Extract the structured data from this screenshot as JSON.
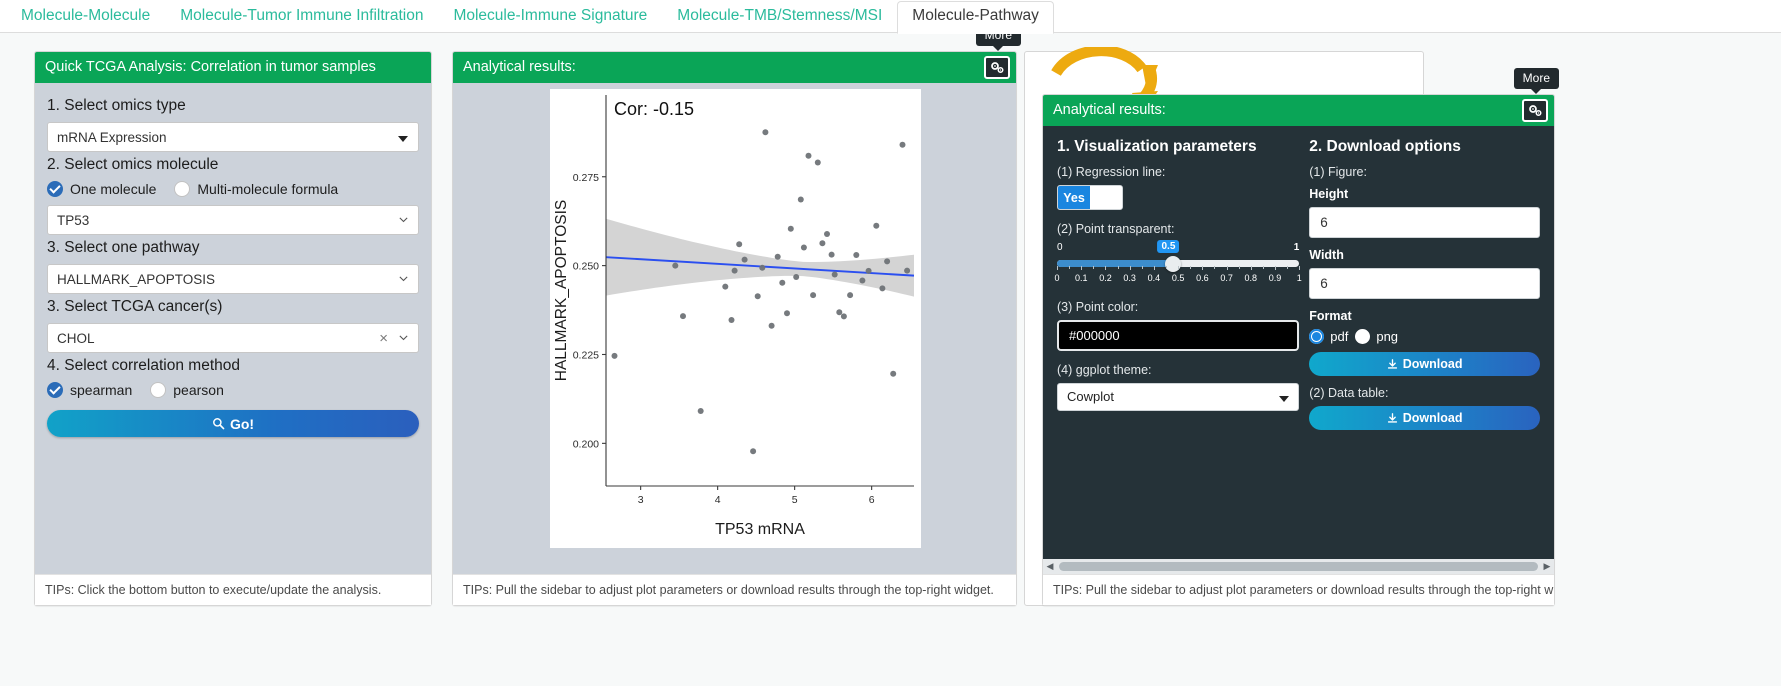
{
  "tabs": [
    {
      "label": "Molecule-Molecule",
      "active": false
    },
    {
      "label": "Molecule-Tumor Immune Infiltration",
      "active": false
    },
    {
      "label": "Molecule-Immune Signature",
      "active": false
    },
    {
      "label": "Molecule-TMB/Stemness/MSI",
      "active": false
    },
    {
      "label": "Molecule-Pathway",
      "active": true
    }
  ],
  "left_panel": {
    "title": "Quick TCGA Analysis: Correlation in tumor samples",
    "step1_label": "1. Select omics type",
    "omics_type_value": "mRNA Expression",
    "step2_label": "2. Select omics molecule",
    "molecule_mode": [
      {
        "label": "One molecule",
        "selected": true
      },
      {
        "label": "Multi-molecule formula",
        "selected": false
      }
    ],
    "molecule_value": "TP53",
    "step3_label": "3. Select one pathway",
    "pathway_value": "HALLMARK_APOPTOSIS",
    "step3b_label": "3. Select TCGA cancer(s)",
    "cancer_value": "CHOL",
    "step4_label": "4. Select correlation method",
    "corr_methods": [
      {
        "label": "spearman",
        "selected": true
      },
      {
        "label": "pearson",
        "selected": false
      }
    ],
    "go_label": "Go!",
    "tip": "TIPs: Click the bottom button to execute/update the analysis."
  },
  "mid_panel": {
    "title": "Analytical results:",
    "gear_tooltip": "More",
    "tip": "TIPs: Pull the sidebar to adjust plot parameters or download results through the top-right widget."
  },
  "right_panel": {
    "title": "Analytical results:",
    "gear_tooltip": "More",
    "viz_title": "1. Visualization parameters",
    "regression_label": "(1) Regression line:",
    "regression_value": "Yes",
    "transparent_label": "(2) Point transparent:",
    "slider_min": "0",
    "slider_max": "1",
    "slider_value": "0.5",
    "slider_ticks": [
      "0",
      "0.1",
      "0.2",
      "0.3",
      "0.4",
      "0.5",
      "0.6",
      "0.7",
      "0.8",
      "0.9",
      "1"
    ],
    "pointcolor_label": "(3) Point color:",
    "pointcolor_value": "#000000",
    "theme_label": "(4) ggplot theme:",
    "theme_value": "Cowplot",
    "download_title": "2. Download options",
    "figure_label": "(1) Figure:",
    "height_label": "Height",
    "height_value": "6",
    "width_label": "Width",
    "width_value": "6",
    "format_label": "Format",
    "formats": [
      {
        "label": "pdf",
        "selected": true
      },
      {
        "label": "png",
        "selected": false
      }
    ],
    "download_fig_label": "Download",
    "datatable_label": "(2) Data table:",
    "download_data_label": "Download",
    "tip": "TIPs: Pull the sidebar to adjust plot parameters or download results through the top-right widget."
  },
  "colors": {
    "accent_green": "#0aa557",
    "tab_teal": "#2bbb9c",
    "panel_body": "#ccd2da",
    "dark_panel": "#253238",
    "regression_line": "#2b4ff0",
    "point_gray": "#6f7377",
    "ribbon_gray": "#d4d4d4",
    "arrow_gold": "#edaa10"
  },
  "chart_data": {
    "type": "scatter",
    "title": "Cor: -0.15",
    "xlabel": "TP53 mRNA",
    "ylabel": "HALLMARK_APOPTOSIS",
    "xticks": [
      3,
      4,
      5,
      6
    ],
    "yticks": [
      0.2,
      0.225,
      0.25,
      0.275
    ],
    "xlim": [
      2.55,
      6.55
    ],
    "ylim": [
      0.188,
      0.298
    ],
    "grid": false,
    "legend": false,
    "regression_line": {
      "show": true,
      "color": "#2b4ff0",
      "slope": -0.0013,
      "intercept": 0.2557
    },
    "confidence_band": {
      "show": true,
      "color": "#d4d4d4",
      "level": 0.95
    },
    "points": [
      {
        "x": 2.66,
        "y": 0.2246
      },
      {
        "x": 3.45,
        "y": 0.25
      },
      {
        "x": 3.55,
        "y": 0.2358
      },
      {
        "x": 3.78,
        "y": 0.2091
      },
      {
        "x": 4.1,
        "y": 0.2441
      },
      {
        "x": 4.18,
        "y": 0.2347
      },
      {
        "x": 4.22,
        "y": 0.2486
      },
      {
        "x": 4.28,
        "y": 0.256
      },
      {
        "x": 4.35,
        "y": 0.2517
      },
      {
        "x": 4.46,
        "y": 0.1978
      },
      {
        "x": 4.52,
        "y": 0.2414
      },
      {
        "x": 4.58,
        "y": 0.2494
      },
      {
        "x": 4.62,
        "y": 0.2875
      },
      {
        "x": 4.7,
        "y": 0.2331
      },
      {
        "x": 4.78,
        "y": 0.2525
      },
      {
        "x": 4.84,
        "y": 0.2452
      },
      {
        "x": 4.9,
        "y": 0.2366
      },
      {
        "x": 4.95,
        "y": 0.2604
      },
      {
        "x": 5.02,
        "y": 0.2468
      },
      {
        "x": 5.08,
        "y": 0.2686
      },
      {
        "x": 5.12,
        "y": 0.2551
      },
      {
        "x": 5.18,
        "y": 0.2809
      },
      {
        "x": 5.24,
        "y": 0.2417
      },
      {
        "x": 5.3,
        "y": 0.279
      },
      {
        "x": 5.36,
        "y": 0.2563
      },
      {
        "x": 5.42,
        "y": 0.2589
      },
      {
        "x": 5.48,
        "y": 0.2531
      },
      {
        "x": 5.52,
        "y": 0.2475
      },
      {
        "x": 5.58,
        "y": 0.2369
      },
      {
        "x": 5.64,
        "y": 0.2357
      },
      {
        "x": 5.72,
        "y": 0.2417
      },
      {
        "x": 5.8,
        "y": 0.253
      },
      {
        "x": 5.88,
        "y": 0.2458
      },
      {
        "x": 5.96,
        "y": 0.2485
      },
      {
        "x": 6.06,
        "y": 0.2612
      },
      {
        "x": 6.14,
        "y": 0.2436
      },
      {
        "x": 6.2,
        "y": 0.2512
      },
      {
        "x": 6.28,
        "y": 0.2196
      },
      {
        "x": 6.4,
        "y": 0.284
      },
      {
        "x": 6.46,
        "y": 0.2486
      }
    ]
  }
}
